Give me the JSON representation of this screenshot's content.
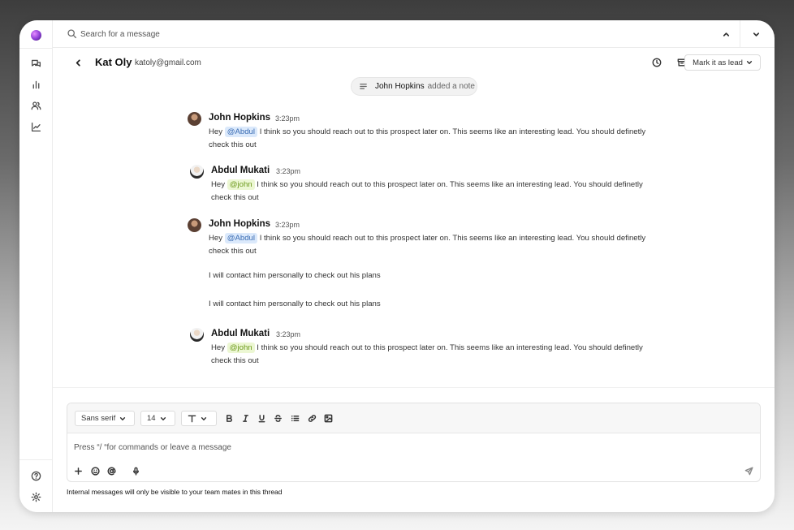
{
  "app": {
    "accent_color": "#8a3bd4"
  },
  "search": {
    "placeholder": "Search for a message"
  },
  "rail": {
    "items": [
      {
        "icon": "chat-bubbles-icon"
      },
      {
        "icon": "bar-chart-icon"
      },
      {
        "icon": "users-icon"
      },
      {
        "icon": "line-chart-icon"
      }
    ],
    "bottom": [
      {
        "icon": "help-icon"
      },
      {
        "icon": "gear-icon"
      }
    ]
  },
  "header": {
    "name": "Kat Oly",
    "email": "katoly@gmail.com",
    "lead_button": "Mark it as lead"
  },
  "note_event": {
    "author": "John Hopkins",
    "action": "added a note"
  },
  "messages": [
    {
      "author": "John Hopkins",
      "time": "3:23pm",
      "prefix": "Hey",
      "mention": "@Abdul",
      "text": "I think so you should reach out to this prospect later on. This seems like an interesting lead. You should definetly",
      "text2": "check this out"
    },
    {
      "author": "Abdul Mukati",
      "time": "3:23pm",
      "prefix": "Hey",
      "mention": "@john",
      "text": "I think so you should reach out to this prospect later on. This seems like an interesting lead. You should definetly",
      "text2": "check this out"
    },
    {
      "author": "John Hopkins",
      "time": "3:23pm",
      "prefix": "Hey",
      "mention": "@Abdul",
      "text": "I think so you should reach out to this prospect later on. This seems like an interesting lead. You should definetly",
      "text2": "check this out",
      "extra": [
        "I will contact him personally to check out his plans",
        "I will contact him personally to check out his plans"
      ]
    },
    {
      "author": "Abdul Mukati",
      "time": "3:23pm",
      "prefix": "Hey",
      "mention": "@john",
      "text": "I think so you should reach out to this prospect later on. This seems like an interesting lead. You should definetly",
      "text2": "check this out"
    }
  ],
  "composer": {
    "font": "Sans serif",
    "size": "14",
    "placeholder": "Press “/ “for commands or leave a message",
    "hint": "Internal messages will only be visible to your team mates in this thread"
  }
}
